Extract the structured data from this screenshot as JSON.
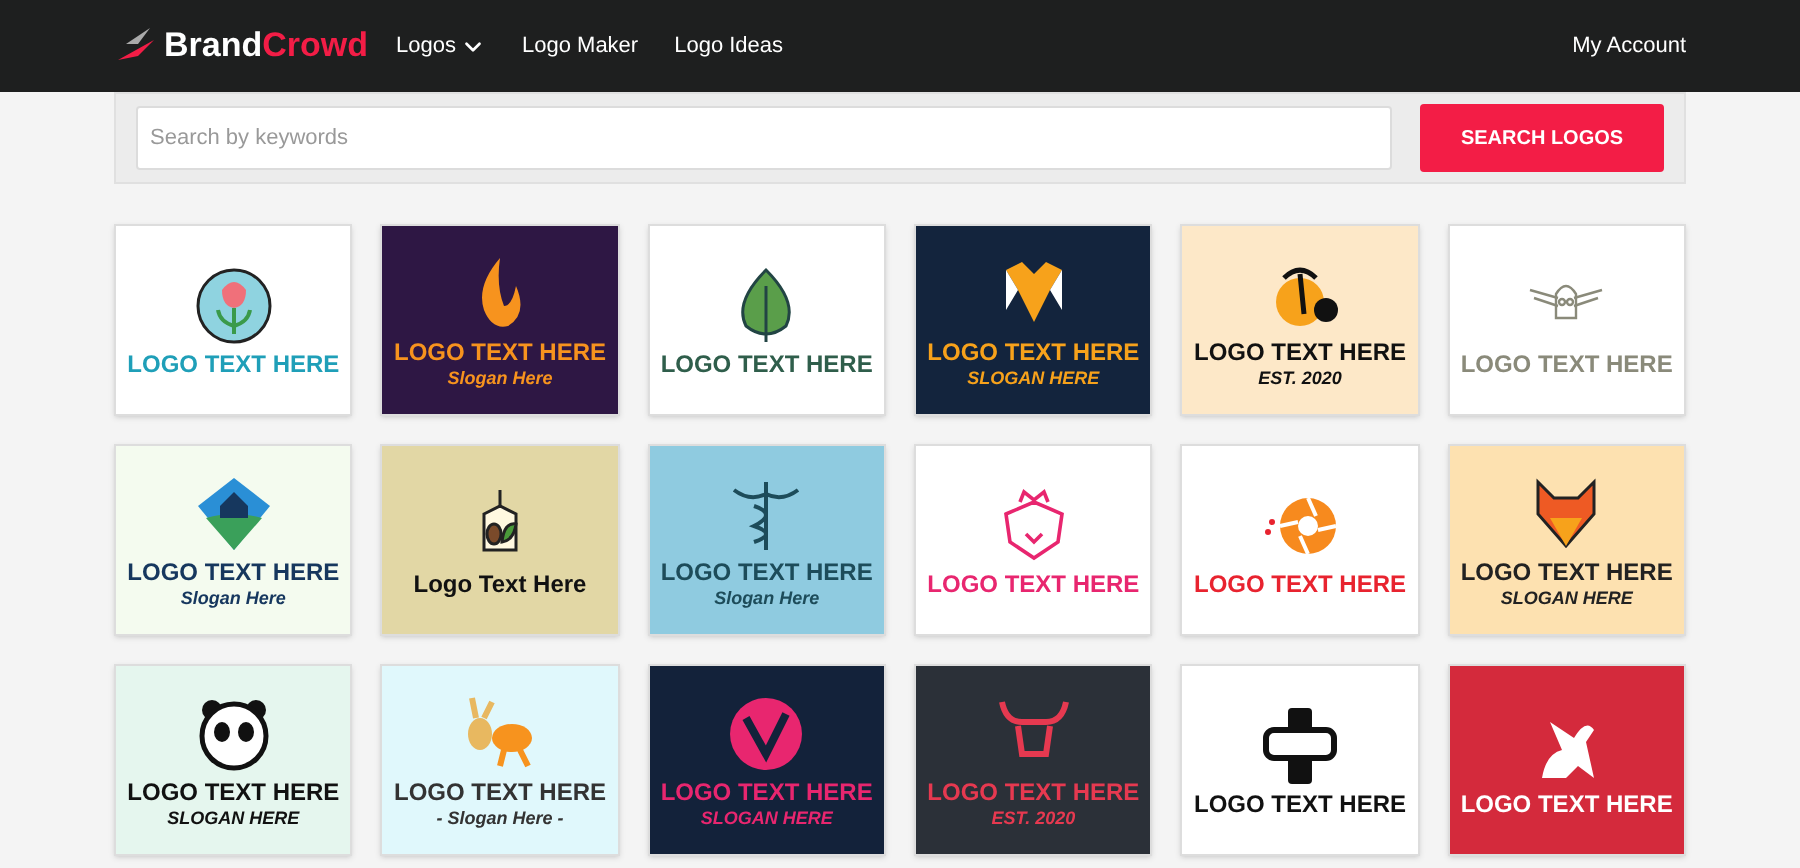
{
  "header": {
    "brand_first": "Brand",
    "brand_second": "Crowd",
    "nav": [
      {
        "label": "Logos",
        "dropdown": true
      },
      {
        "label": "Logo Maker",
        "dropdown": false
      },
      {
        "label": "Logo Ideas",
        "dropdown": false
      }
    ],
    "account": "My Account"
  },
  "search": {
    "placeholder": "Search by keywords",
    "button": "SEARCH LOGOS"
  },
  "logos": [
    {
      "kind": "tulip",
      "color": "#1f9fb8",
      "title": "LOGO TEXT HERE"
    },
    {
      "kind": "flame",
      "color": "#f7931e",
      "title": "LOGO TEXT HERE",
      "slogan": "Slogan Here"
    },
    {
      "kind": "leaf",
      "color": "#2f5e4b",
      "title": "LOGO TEXT HERE"
    },
    {
      "kind": "pattern",
      "color": "#f7a21b",
      "title": "LOGO TEXT HERE",
      "slogan": "SLOGAN HERE"
    },
    {
      "kind": "palm",
      "color": "#111111",
      "title": "LOGO TEXT HERE",
      "slogan": "EST. 2020"
    },
    {
      "kind": "skull",
      "color": "#8a8a7a",
      "title": "LOGO TEXT HERE"
    },
    {
      "kind": "house",
      "color": "#16375e",
      "title": "LOGO TEXT HERE",
      "slogan": "Slogan Here"
    },
    {
      "kind": "tea",
      "color": "#111111",
      "title": "Logo Text Here"
    },
    {
      "kind": "caduceus",
      "color": "#1d4c5a",
      "title": "LOGO TEXT HERE",
      "slogan": "Slogan Here"
    },
    {
      "kind": "lion",
      "color": "#e8266f",
      "title": "LOGO TEXT HERE"
    },
    {
      "kind": "aperture",
      "color": "#e8232f",
      "title": "LOGO TEXT HERE"
    },
    {
      "kind": "fox",
      "color": "#222222",
      "title": "LOGO TEXT HERE",
      "slogan": "SLOGAN HERE"
    },
    {
      "kind": "panda",
      "color": "#111111",
      "title": "LOGO TEXT HERE",
      "slogan": "SLOGAN HERE"
    },
    {
      "kind": "donkey",
      "color": "#333333",
      "title": "LOGO TEXT HERE",
      "slogan": "- Slogan Here -"
    },
    {
      "kind": "swirl",
      "color": "#e8266f",
      "title": "LOGO TEXT HERE",
      "slogan": "SLOGAN HERE"
    },
    {
      "kind": "bull",
      "color": "#e63950",
      "title": "LOGO TEXT HERE",
      "slogan": "EST. 2020"
    },
    {
      "kind": "headset",
      "color": "#111111",
      "title": "LOGO TEXT HERE"
    },
    {
      "kind": "dragon",
      "color": "#ffffff",
      "title": "LOGO TEXT HERE"
    }
  ]
}
